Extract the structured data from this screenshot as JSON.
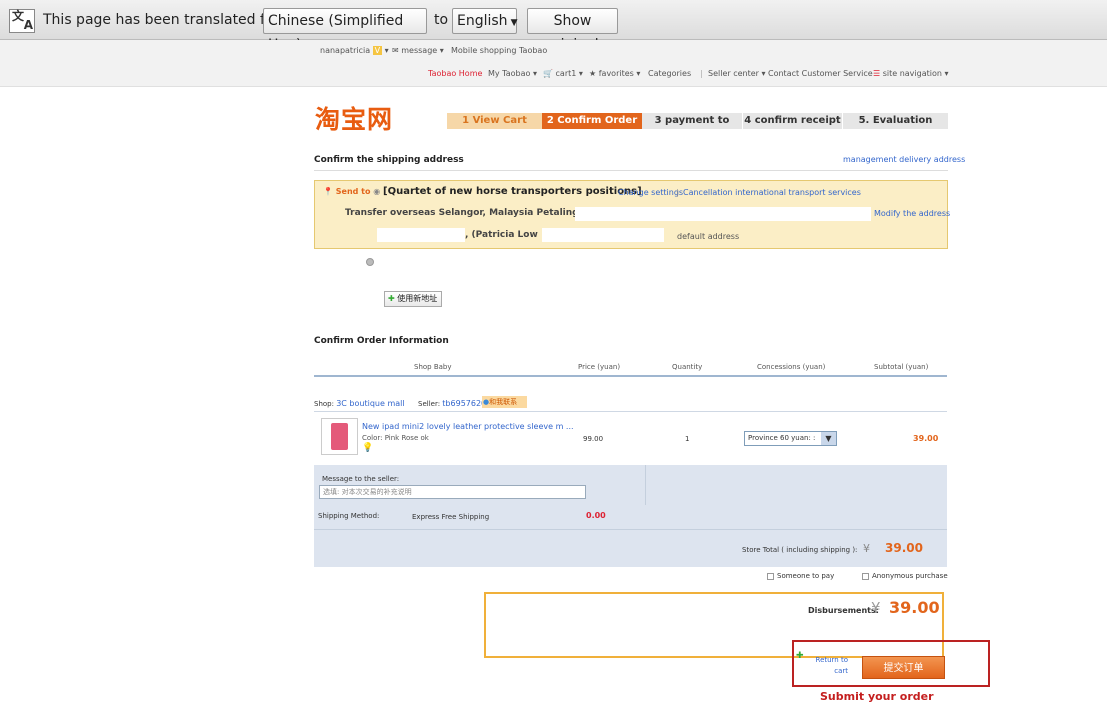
{
  "translate_bar": {
    "icon": "translate-icon",
    "message": "This page has been translated from",
    "source_lang": "Chinese (Simplified Han)",
    "to": "to",
    "target_lang": "English",
    "show_original": "Show original"
  },
  "site_nav": {
    "username": "nanapatricia",
    "message": "message",
    "mobile": "Mobile shopping Taobao",
    "home": "Taobao Home",
    "my_taobao": "My Taobao",
    "cart": "cart1",
    "favorites": "favorites",
    "categories": "Categories",
    "seller_center": "Seller center",
    "customer_service": "Contact Customer Service",
    "site_navigation": "site navigation"
  },
  "logo": "淘宝网",
  "steps": [
    "1 View Cart",
    "2 Confirm Order",
    "3 payment to",
    "4 confirm receipt",
    "5. Evaluation"
  ],
  "shipping": {
    "title": "Confirm the shipping address",
    "manage_link": "management delivery address",
    "send_to": "Send to",
    "address_title": "[Quartet of new horse transporters positions]",
    "change_settings": "Change settings",
    "cancel_transport": "Cancellation international transport services",
    "address_line": "Transfer overseas Selangor, Malaysia Petaling",
    "modify": "Modify the address",
    "recipient": ", (Patricia Low",
    "default_address": "default address",
    "new_address_button": "使用新地址"
  },
  "order": {
    "title": "Confirm Order Information",
    "headers": [
      "Shop Baby",
      "Price (yuan)",
      "Quantity",
      "Concessions (yuan)",
      "Subtotal (yuan)"
    ],
    "shop_label": "Shop:",
    "shop_name": "3C boutique mall",
    "seller_label": "Seller:",
    "seller_name": "tb6957620",
    "contact_badge": "和我联系",
    "item": {
      "title": "New ipad mini2 lovely leather protective sleeve m ...",
      "color": "Color: Pink Rose ok",
      "price": "99.00",
      "quantity": "1",
      "concession": "Province 60 yuan: :",
      "subtotal": "39.00"
    },
    "message_label": "Message to the seller:",
    "message_placeholder": "选填: 对本次交易的补充说明",
    "shipping_method_label": "Shipping Method:",
    "shipping_method": "Express  Free Shipping",
    "shipping_cost": "0.00",
    "store_total_label": "Store Total ( including shipping ):",
    "currency": "¥",
    "store_total": "39.00",
    "someone_pay": "Someone to pay",
    "anonymous": "Anonymous purchase",
    "disbursements_label": "Disbursements:",
    "disbursements": "39.00",
    "return_cart": "Return to cart",
    "submit_cn": "提交订单",
    "submit_caption": "Submit your order"
  },
  "colors": {
    "accent": "#e2651c",
    "link": "#3366cc",
    "highlight_red": "#b22222"
  }
}
